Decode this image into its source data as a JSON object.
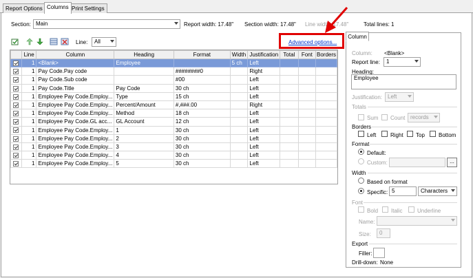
{
  "tabs": [
    {
      "label": "Report Options"
    },
    {
      "label": "Columns"
    },
    {
      "label": "Print Settings"
    }
  ],
  "header": {
    "section_label": "Section:",
    "section_value": "Main",
    "report_width": "Report width: 17.48\"",
    "section_width": "Section width: 17.48\"",
    "line_width": "Line width: 17.48\"",
    "total_lines": "Total lines: 1"
  },
  "toolbar": {
    "line_label": "Line:",
    "line_value": "All",
    "advanced_options": "Advanced options..."
  },
  "grid": {
    "columns": [
      "Line",
      "Column",
      "Heading",
      "Format",
      "Width",
      "Justification",
      "Total",
      "Font",
      "Borders"
    ],
    "rows": [
      {
        "line": "1",
        "column": "<Blank>",
        "heading": "Employee",
        "format": "",
        "width": "5 ch",
        "justification": "Left",
        "selected": true
      },
      {
        "line": "1",
        "column": "Pay Code.Pay code",
        "heading": "",
        "format": "########0",
        "width": "",
        "justification": "Right"
      },
      {
        "line": "1",
        "column": "Pay Code.Sub code",
        "heading": "",
        "format": "#00",
        "width": "",
        "justification": "Left"
      },
      {
        "line": "1",
        "column": "Pay Code.Title",
        "heading": "Pay Code",
        "format": "30 ch",
        "width": "",
        "justification": "Left"
      },
      {
        "line": "1",
        "column": "Employee Pay Code.Employ...",
        "heading": "Type",
        "format": "15 ch",
        "width": "",
        "justification": "Left"
      },
      {
        "line": "1",
        "column": "Employee Pay Code.Employ...",
        "heading": "Percent/Amount",
        "format": "#,###.00",
        "width": "",
        "justification": "Right"
      },
      {
        "line": "1",
        "column": "Employee Pay Code.Employ...",
        "heading": "Method",
        "format": "18 ch",
        "width": "",
        "justification": "Left"
      },
      {
        "line": "1",
        "column": "Employee Pay Code.GL acc...",
        "heading": "GL Account",
        "format": "12 ch",
        "width": "",
        "justification": "Left"
      },
      {
        "line": "1",
        "column": "Employee Pay Code.Employ...",
        "heading": "1",
        "format": "30 ch",
        "width": "",
        "justification": "Left"
      },
      {
        "line": "1",
        "column": "Employee Pay Code.Employ...",
        "heading": "2",
        "format": "30 ch",
        "width": "",
        "justification": "Left"
      },
      {
        "line": "1",
        "column": "Employee Pay Code.Employ...",
        "heading": "3",
        "format": "30 ch",
        "width": "",
        "justification": "Left"
      },
      {
        "line": "1",
        "column": "Employee Pay Code.Employ...",
        "heading": "4",
        "format": "30 ch",
        "width": "",
        "justification": "Left"
      },
      {
        "line": "1",
        "column": "Employee Pay Code.Employ...",
        "heading": "5",
        "format": "30 ch",
        "width": "",
        "justification": "Left"
      }
    ]
  },
  "column_panel": {
    "tab_label": "Column",
    "column_label": "Column:",
    "column_value": "<Blank>",
    "report_line_label": "Report line:",
    "report_line_value": "1",
    "heading_label": "Heading:",
    "heading_value": "Employee",
    "justification_label": "Justification:",
    "justification_value": "Left",
    "totals_label": "Totals",
    "sum_label": "Sum",
    "count_label": "Count",
    "records_value": "records",
    "borders_label": "Borders",
    "border_left": "Left",
    "border_right": "Right",
    "border_top": "Top",
    "border_bottom": "Bottom",
    "format_label": "Format",
    "default_label": "Default:",
    "custom_label": "Custom:",
    "browse_label": "...",
    "width_label": "Width",
    "based_on_format": "Based on format",
    "specific_label": "Specific:",
    "specific_value": "5",
    "units_value": "Characters",
    "font_label": "Font",
    "bold_label": "Bold",
    "italic_label": "Italic",
    "underline_label": "Underline",
    "name_label": "Name:",
    "size_label": "Size:",
    "size_value": "0",
    "export_label": "Export",
    "filler_label": "Filler:",
    "drilldown_label": "Drill-down:",
    "drilldown_value": "None"
  },
  "colors": {
    "selection": "#7a9ad8",
    "highlight_box": "#e00000",
    "arrow": "#e00000",
    "link": "#0033cc"
  }
}
